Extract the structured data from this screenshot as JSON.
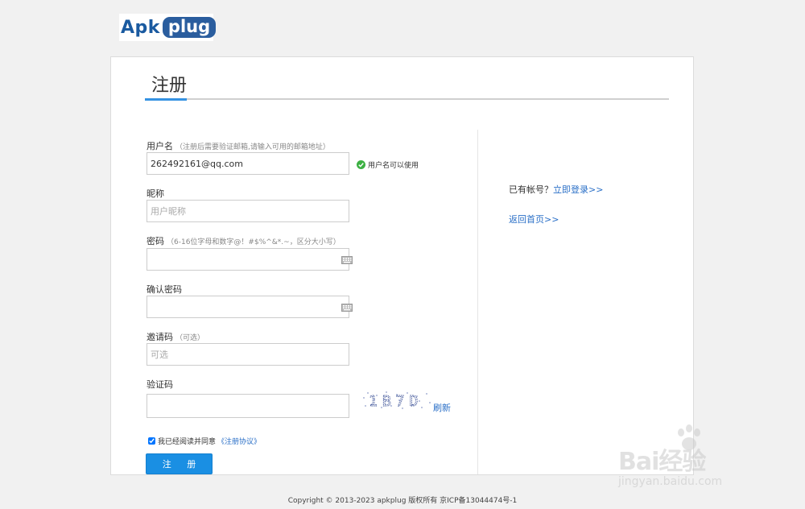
{
  "logo": {
    "part1": "Apk",
    "part2": "plug"
  },
  "form": {
    "title": "注册",
    "username": {
      "label": "用户名",
      "hint": "（注册后需要验证邮箱,请输入可用的邮箱地址）",
      "value": "262492161@qq.com",
      "status": "用户名可以使用"
    },
    "nickname": {
      "label": "昵称",
      "placeholder": "用户昵称"
    },
    "password": {
      "label": "密码",
      "hint": "（6-16位字母和数字@！#$%^&*.~，区分大小写）"
    },
    "confirm": {
      "label": "确认密码"
    },
    "invite": {
      "label": "邀请码",
      "hint": "（可选）",
      "placeholder": "可选"
    },
    "captcha": {
      "label": "验证码",
      "image_text": "1B7D",
      "refresh": "刷新"
    },
    "agree": {
      "text": "我已经阅读并同意",
      "link": "《注册协议》",
      "checked": true
    },
    "submit": "注 册"
  },
  "side": {
    "have_account": "已有帐号？",
    "login_link": "立即登录>>",
    "home_link": "返回首页>>"
  },
  "footer": "Copyright © 2013-2023 apkplug 版权所有 京ICP备13044474号-1",
  "watermark": {
    "text": "Bai经验",
    "sub": "jingyan.baidu.com"
  },
  "colors": {
    "accent": "#3592e2",
    "button": "#1a8fe3",
    "link": "#2a6fc7",
    "ok": "#3cb043"
  }
}
